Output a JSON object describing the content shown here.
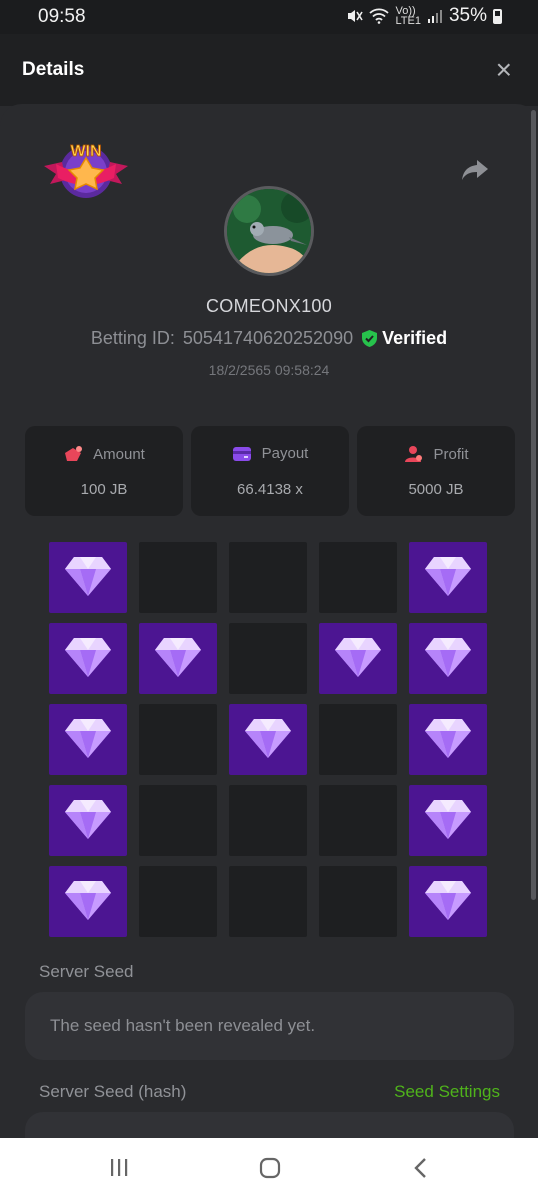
{
  "status_bar": {
    "time": "09:58",
    "volte_label": "Vo))",
    "lte_label": "LTE1",
    "battery": "35%"
  },
  "header": {
    "title": "Details",
    "close_icon": "×"
  },
  "badge": {
    "win_text": "WIN"
  },
  "player": {
    "username": "COMEONX100",
    "betting_id_label": "Betting ID:",
    "betting_id": "50541740620252090",
    "verified_label": "Verified",
    "timestamp": "18/2/2565 09:58:24"
  },
  "stats": [
    {
      "label": "Amount",
      "value": "100 JB",
      "icon": "amount-icon",
      "color": "#e8465a"
    },
    {
      "label": "Payout",
      "value": "66.4138 x",
      "icon": "wallet-icon",
      "color": "#8a4bea"
    },
    {
      "label": "Profit",
      "value": "5000 JB",
      "icon": "profit-icon",
      "color": "#e8465a"
    }
  ],
  "board": {
    "rows": 5,
    "cols": 5,
    "gems": [
      [
        1,
        0,
        0,
        0,
        1
      ],
      [
        1,
        1,
        0,
        1,
        1
      ],
      [
        1,
        0,
        1,
        0,
        1
      ],
      [
        1,
        0,
        0,
        0,
        1
      ],
      [
        1,
        0,
        0,
        0,
        1
      ]
    ]
  },
  "server_seed": {
    "label": "Server Seed",
    "value": "The seed hasn't been revealed yet."
  },
  "server_seed_hash": {
    "label": "Server Seed (hash)",
    "settings_link": "Seed Settings"
  },
  "colors": {
    "gem_tile": "#4c1592",
    "empty_tile": "#1e1f21",
    "accent_green": "#4fb31b",
    "verified_green": "#27c24c"
  }
}
